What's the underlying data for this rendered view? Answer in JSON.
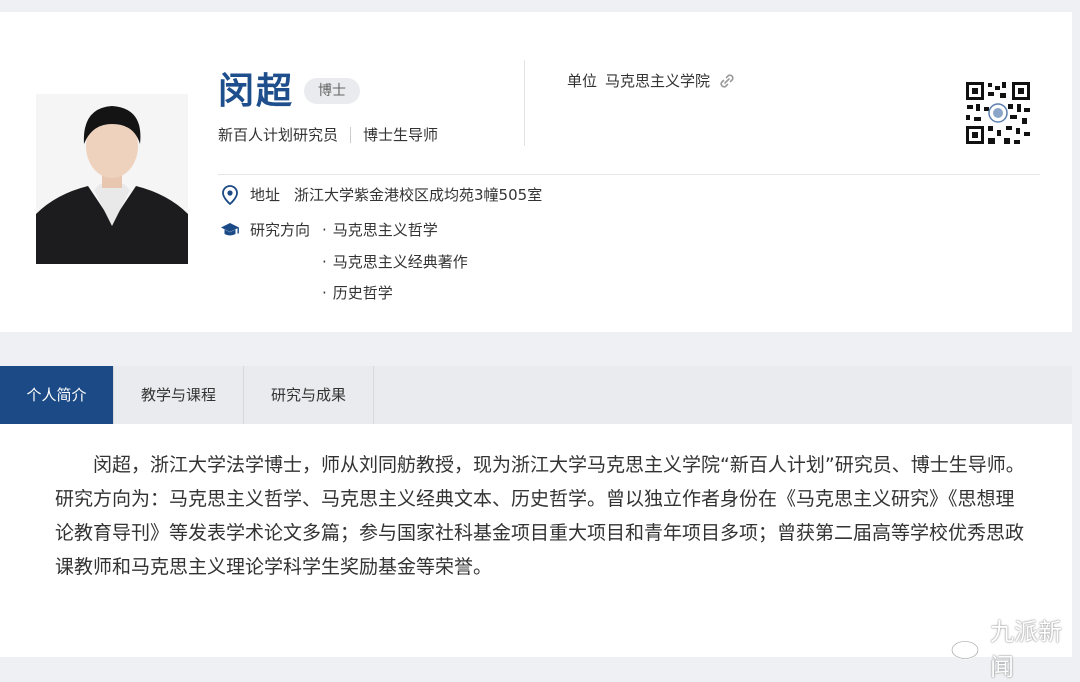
{
  "profile": {
    "name": "闵超",
    "degree": "博士",
    "title_1": "新百人计划研究员",
    "title_2": "博士生导师",
    "unit_label": "单位",
    "unit_value": "马克思主义学院",
    "address_label": "地址",
    "address_value": "浙江大学紫金港校区成均苑3幢505室",
    "research_label": "研究方向",
    "research_items": [
      "马克思主义哲学",
      "马克思主义经典著作",
      "历史哲学"
    ]
  },
  "tabs": [
    {
      "label": "个人简介",
      "active": true
    },
    {
      "label": "教学与课程",
      "active": false
    },
    {
      "label": "研究与成果",
      "active": false
    }
  ],
  "bio": "闵超，浙江大学法学博士，师从刘同舫教授，现为浙江大学马克思主义学院“新百人计划”研究员、博士生导师。研究方向为：马克思主义哲学、马克思主义经典文本、历史哲学。曾以独立作者身份在《马克思主义研究》《思想理论教育导刊》等发表学术论文多篇；参与国家社科基金项目重大项目和青年项目多项；曾获第二届高等学校优秀思政课教师和马克思主义理论学科学生奖励基金等荣誉。",
  "watermark": "九派新闻",
  "colors": {
    "brand": "#1b4a86",
    "name": "#1e4f8c"
  },
  "icons": [
    "location-icon",
    "graduation-cap-icon",
    "link-icon",
    "qr-code-icon",
    "weibo-icon"
  ]
}
